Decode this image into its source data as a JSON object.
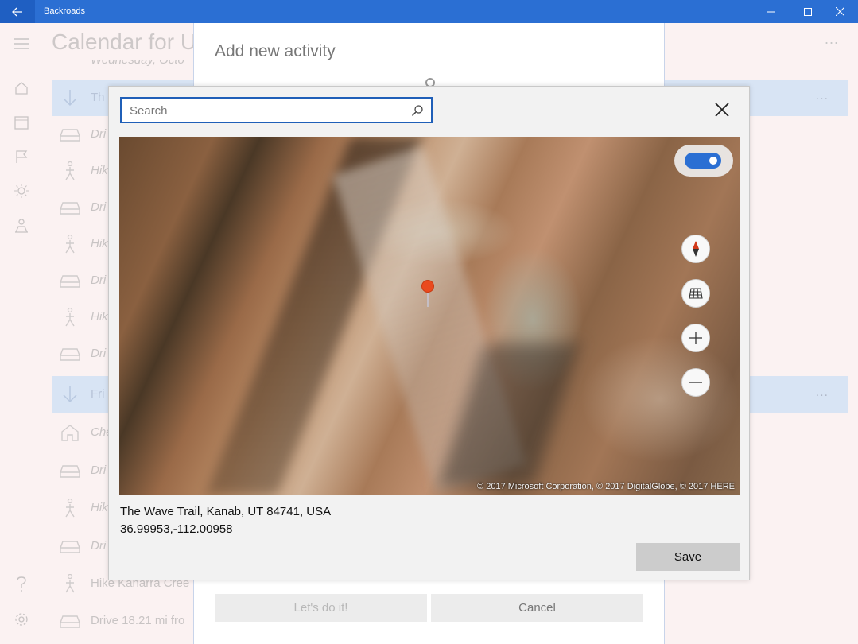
{
  "window": {
    "title": "Backroads",
    "accent": "#2b6fd3"
  },
  "background": {
    "page_title": "Calendar for U",
    "more_label": "...",
    "rows": [
      {
        "text": "Wednesday, Octo",
        "kind": "partial-header",
        "icon": "chevron-icon"
      },
      {
        "text": "Th",
        "kind": "day-header",
        "icon": "arrow-down-icon"
      },
      {
        "text": "Dri",
        "kind": "drive",
        "icon": "car-icon"
      },
      {
        "text": "Hik",
        "kind": "hike",
        "icon": "hiker-icon"
      },
      {
        "text": "Dri",
        "kind": "drive",
        "icon": "car-icon"
      },
      {
        "text": "Hik",
        "kind": "hike",
        "icon": "hiker-icon"
      },
      {
        "text": "Dri",
        "kind": "drive",
        "icon": "car-icon"
      },
      {
        "text": "Hik",
        "kind": "hike",
        "icon": "hiker-icon"
      },
      {
        "text": "Dri",
        "kind": "drive",
        "icon": "car-icon"
      },
      {
        "text": "Fri",
        "kind": "day-header",
        "icon": "arrow-down-icon"
      },
      {
        "text": "Che",
        "kind": "checkin",
        "icon": "house-icon"
      },
      {
        "text": "Dri",
        "kind": "drive",
        "icon": "car-icon"
      },
      {
        "text": "Hik",
        "kind": "hike",
        "icon": "hiker-icon"
      },
      {
        "text": "Dri",
        "kind": "drive",
        "icon": "car-icon"
      },
      {
        "text": "Hike Kanarra Cree",
        "kind": "hike",
        "icon": "hiker-icon"
      },
      {
        "text": "Drive 18.21 mi fro",
        "kind": "drive",
        "icon": "car-icon"
      }
    ]
  },
  "activity_panel": {
    "title": "Add new activity",
    "confirm_label": "Let's do it!",
    "cancel_label": "Cancel"
  },
  "dialog": {
    "search_placeholder": "Search",
    "map_copyright": "© 2017 Microsoft Corporation, © 2017 DigitalGlobe, © 2017 HERE",
    "aerial_toggle_on": true,
    "address": "The Wave Trail, Kanab, UT 84741, USA",
    "coordinates": "36.99953,-112.00958",
    "save_label": "Save",
    "pin_color": "#ea4a1e"
  }
}
